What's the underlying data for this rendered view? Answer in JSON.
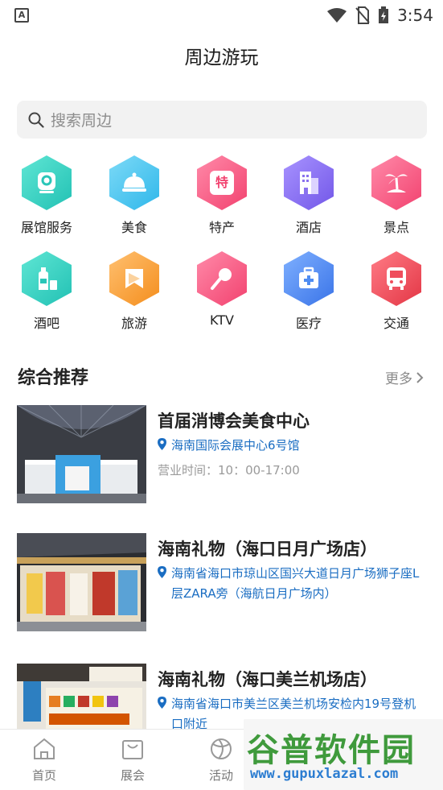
{
  "status_bar": {
    "app_badge": "A",
    "time": "3:54"
  },
  "page_title": "周边游玩",
  "search": {
    "placeholder": "搜索周边"
  },
  "categories": [
    {
      "label": "展馆服务",
      "icon": "venue-pin-icon",
      "color": "#35d2c4"
    },
    {
      "label": "美食",
      "icon": "food-cloche-icon",
      "color": "#44c6ec"
    },
    {
      "label": "特产",
      "icon": "specialty-icon",
      "color": "#f45a86",
      "icon_text": "特"
    },
    {
      "label": "酒店",
      "icon": "hotel-building-icon",
      "color": "#8a72ee"
    },
    {
      "label": "景点",
      "icon": "palm-tree-icon",
      "color": "#f45a86"
    },
    {
      "label": "酒吧",
      "icon": "bar-drink-icon",
      "color": "#35d2c4"
    },
    {
      "label": "旅游",
      "icon": "travel-flag-icon",
      "color": "#f7a63e"
    },
    {
      "label": "KTV",
      "icon": "microphone-icon",
      "color": "#f45a86"
    },
    {
      "label": "医疗",
      "icon": "medical-kit-icon",
      "color": "#4f8cf2"
    },
    {
      "label": "交通",
      "icon": "bus-icon",
      "color": "#ef4d5c"
    }
  ],
  "section": {
    "title": "综合推荐",
    "more": "更多"
  },
  "recommendations": [
    {
      "name": "首届消博会美食中心",
      "address": "海南国际会展中心6号馆",
      "hours": "营业时间：10：00-17:00"
    },
    {
      "name": "海南礼物（海口日月广场店）",
      "address": "海南省海口市琼山区国兴大道日月广场狮子座L层ZARA旁（海航日月广场内）",
      "hours": ""
    },
    {
      "name": "海南礼物（海口美兰机场店）",
      "address": "海南省海口市美兰区美兰机场安检内19号登机口附近",
      "hours": ""
    }
  ],
  "bottom_nav": [
    {
      "label": "首页",
      "icon": "home-icon"
    },
    {
      "label": "展会",
      "icon": "bag-icon"
    },
    {
      "label": "活动",
      "icon": "ball-icon"
    }
  ],
  "watermark": {
    "title": "谷普软件园",
    "url": "www.gupuxlazal.com"
  },
  "colors": {
    "link": "#1a6dc2",
    "search_bg": "#f2f2f2",
    "muted": "#8d8d8d"
  }
}
